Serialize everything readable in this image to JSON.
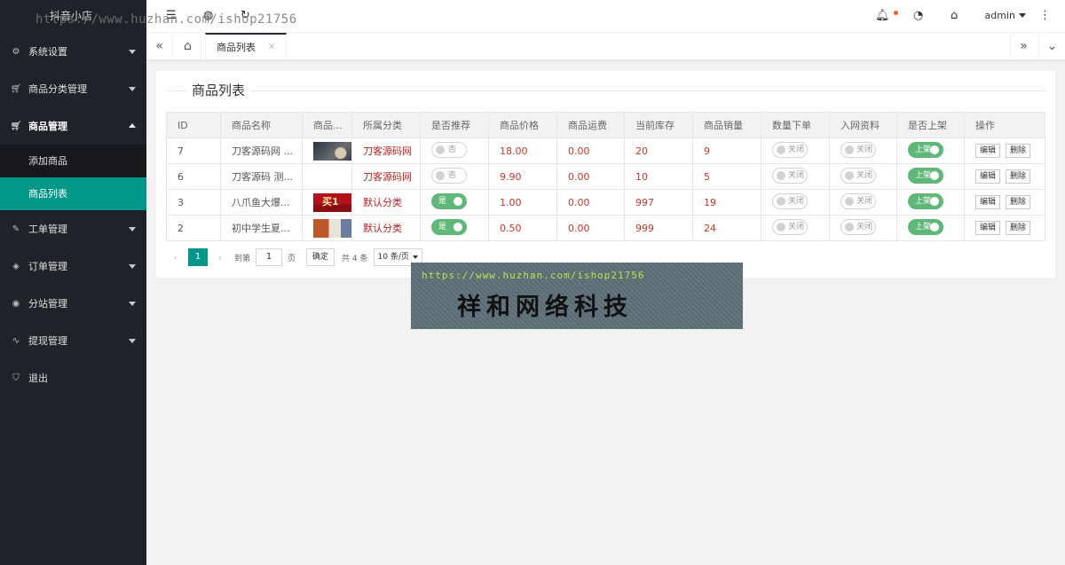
{
  "app": {
    "title": "抖音小店"
  },
  "watermark": {
    "top_url": "https://www.huzhan.com/ishop21756",
    "banner_url": "https://www.huzhan.com/ishop21756",
    "banner_name": "祥和网络科技"
  },
  "header": {
    "user": "admin"
  },
  "sidebar": {
    "items": [
      {
        "label": "系统设置",
        "icon": "gear-icon"
      },
      {
        "label": "商品分类管理",
        "icon": "cart-icon"
      },
      {
        "label": "商品管理",
        "icon": "cart-icon",
        "open": true
      },
      {
        "label": "工单管理",
        "icon": "ticket-icon"
      },
      {
        "label": "订单管理",
        "icon": "layers-icon"
      },
      {
        "label": "分站管理",
        "icon": "globe-icon"
      },
      {
        "label": "提现管理",
        "icon": "chart-icon"
      },
      {
        "label": "退出",
        "icon": "shield-icon"
      }
    ],
    "submenu": [
      {
        "label": "添加商品",
        "active": false
      },
      {
        "label": "商品列表",
        "active": true
      }
    ]
  },
  "tabs": {
    "active": "商品列表"
  },
  "card": {
    "title": "商品列表"
  },
  "table": {
    "columns": [
      "ID",
      "商品名称",
      "商品...",
      "所属分类",
      "是否推荐",
      "商品价格",
      "商品运费",
      "当前库存",
      "商品销量",
      "数量下单",
      "入网资料",
      "是否上架",
      "操作"
    ],
    "rows": [
      {
        "id": "7",
        "name": "刀客源码网 ...",
        "thumb": "moon",
        "category": "刀客源码网",
        "recommend": "否",
        "recommend_on": false,
        "price": "18.00",
        "shipping": "0.00",
        "stock": "20",
        "sales": "9",
        "qty_order": "关闭",
        "net_info": "关闭",
        "listed": "上架"
      },
      {
        "id": "6",
        "name": "刀客源码 测...",
        "thumb": "empty",
        "category": "刀客源码网",
        "recommend": "否",
        "recommend_on": false,
        "price": "9.90",
        "shipping": "0.00",
        "stock": "10",
        "sales": "5",
        "qty_order": "关闭",
        "net_info": "关闭",
        "listed": "上架"
      },
      {
        "id": "3",
        "name": "八爪鱼大爆...",
        "thumb": "red",
        "category": "默认分类",
        "recommend": "是",
        "recommend_on": true,
        "price": "1.00",
        "shipping": "0.00",
        "stock": "997",
        "sales": "19",
        "qty_order": "关闭",
        "net_info": "关闭",
        "listed": "上架"
      },
      {
        "id": "2",
        "name": "初中学生夏...",
        "thumb": "photo",
        "category": "默认分类",
        "recommend": "是",
        "recommend_on": true,
        "price": "0.50",
        "shipping": "0.00",
        "stock": "999",
        "sales": "24",
        "qty_order": "关闭",
        "net_info": "关闭",
        "listed": "上架"
      }
    ],
    "actions": {
      "edit": "编辑",
      "delete": "删除"
    }
  },
  "pager": {
    "current": "1",
    "goto_label": "到第",
    "page_input": "1",
    "page_label": "页",
    "confirm": "确定",
    "total": "共 4 条",
    "page_size": "10 条/页"
  }
}
